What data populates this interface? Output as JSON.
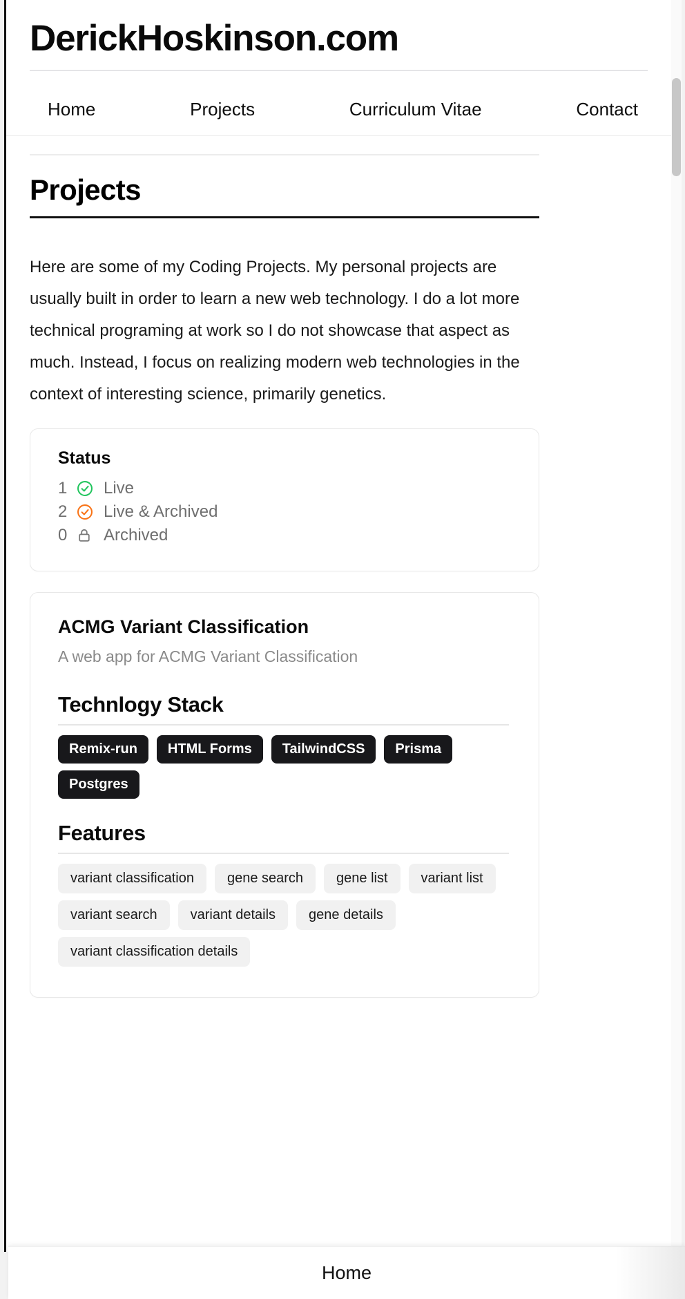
{
  "site": {
    "title": "DerickHoskinson.com"
  },
  "nav": {
    "items": [
      {
        "label": "Home",
        "name": "nav-home"
      },
      {
        "label": "Projects",
        "name": "nav-projects"
      },
      {
        "label": "Curriculum Vitae",
        "name": "nav-curriculum-vitae"
      },
      {
        "label": "Contact",
        "name": "nav-contact"
      }
    ]
  },
  "main": {
    "page_title": "Projects",
    "intro": "Here are some of my Coding Projects. My personal projects are usually built in order to learn a new web technology. I do a lot more technical programing at work so I do not showcase that aspect as much. Instead, I focus on realizing modern web technologies in the context of interesting science, primarily genetics."
  },
  "status_card": {
    "heading": "Status",
    "rows": [
      {
        "count": "1",
        "icon": "check-circle-green-icon",
        "label": "Live",
        "color": "#22c55e"
      },
      {
        "count": "2",
        "icon": "check-circle-orange-icon",
        "label": "Live & Archived",
        "color": "#f97316"
      },
      {
        "count": "0",
        "icon": "lock-icon",
        "label": "Archived",
        "color": "#6f6f6f"
      }
    ]
  },
  "project": {
    "title": "ACMG Variant Classification",
    "description": "A web app for ACMG Variant Classification",
    "tech_heading": "Technlogy Stack",
    "tech_stack": [
      "Remix-run",
      "HTML Forms",
      "TailwindCSS",
      "Prisma",
      "Postgres"
    ],
    "features_heading": "Features",
    "features": [
      "variant classification",
      "gene search",
      "gene list",
      "variant list",
      "variant search",
      "variant details",
      "gene details",
      "variant classification details"
    ]
  },
  "bottom_bar": {
    "label": "Home"
  },
  "colors": {
    "accent_dark": "#18181b",
    "live": "#22c55e",
    "live_archived": "#f97316",
    "archived": "#6f6f6f",
    "muted_text": "#8a8a8a"
  }
}
